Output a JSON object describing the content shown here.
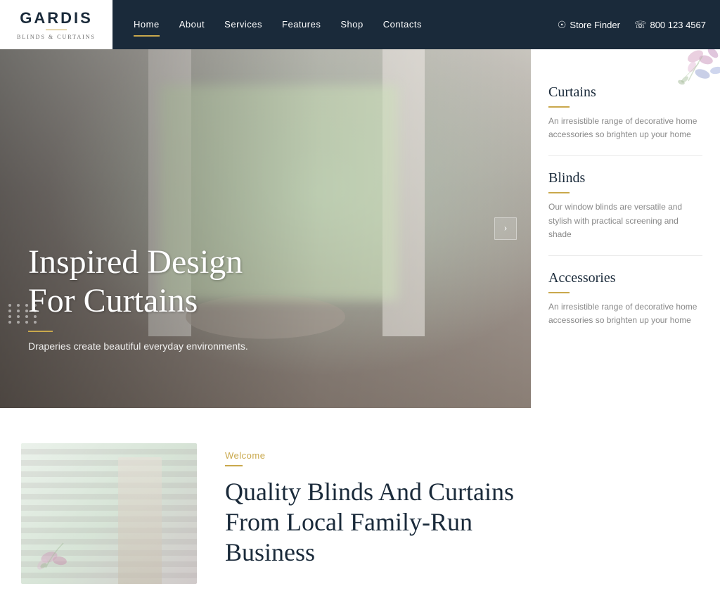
{
  "brand": {
    "name": "GARDIS",
    "tagline": "Blinds & Curtains",
    "logo_line": true
  },
  "navbar": {
    "links": [
      {
        "label": "Home",
        "active": true
      },
      {
        "label": "About",
        "active": false
      },
      {
        "label": "Services",
        "active": false
      },
      {
        "label": "Features",
        "active": false
      },
      {
        "label": "Shop",
        "active": false
      },
      {
        "label": "Contacts",
        "active": false
      }
    ],
    "store_finder": "Store Finder",
    "phone": "800 123 4567"
  },
  "hero": {
    "title_line1": "Inspired Design",
    "title_line2": "For Curtains",
    "subtitle": "Draperies create beautiful everyday environments."
  },
  "categories": [
    {
      "title": "Curtains",
      "description": "An irresistible range of decorative home accessories so brighten up your home"
    },
    {
      "title": "Blinds",
      "description": "Our window blinds are versatile and stylish with practical screening and shade"
    },
    {
      "title": "Accessories",
      "description": "An irresistible range of decorative home accessories so brighten up your home"
    }
  ],
  "welcome_section": {
    "label": "Welcome",
    "heading_line1": "Quality Blinds And Curtains",
    "heading_line2": "From Local Family-Run",
    "heading_line3": "Business"
  },
  "colors": {
    "accent": "#c9a84c",
    "dark_navy": "#1a2a3a",
    "text_gray": "#888888"
  }
}
